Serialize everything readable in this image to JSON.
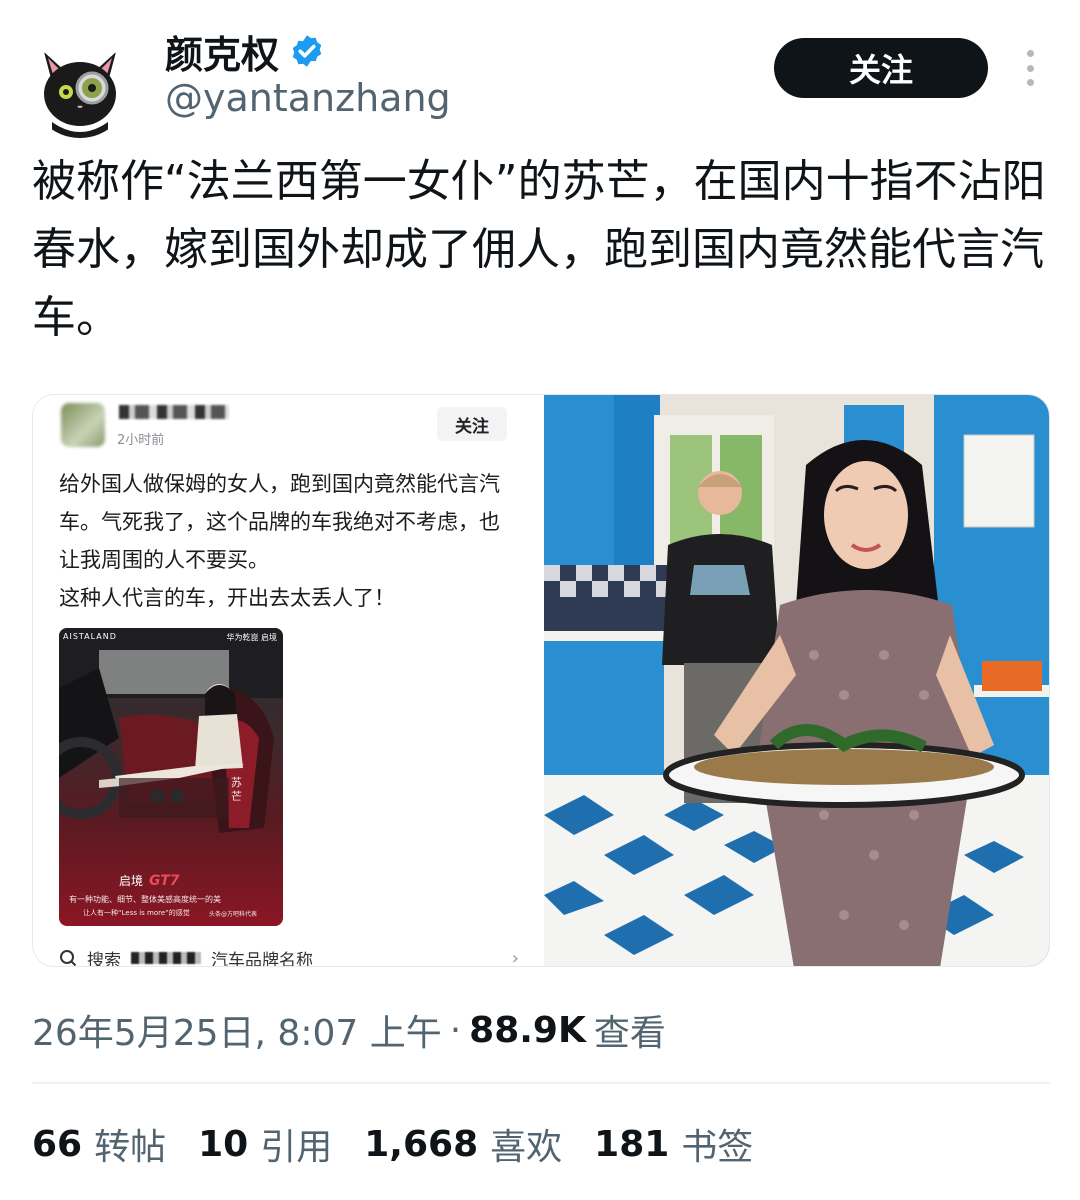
{
  "author": {
    "display_name": "颜克权",
    "handle": "@yantanzhang",
    "verified": true,
    "avatar": "black-cat-avatar"
  },
  "actions": {
    "follow_label": "关注",
    "more_icon": "more-vertical-icon"
  },
  "tweet": {
    "text": "被称作“法兰西第一女仆”的苏芒，在国内十指不沾阳春水，嫁到国外却成了佣人，跑到国内竟然能代言汽车。"
  },
  "media": {
    "left": {
      "post_time": "2小时前",
      "follow_label": "关注",
      "post_text": "给外国人做保姆的女人，跑到国内竟然能代言汽车。气死我了，这个品牌的车我绝对不考虑，也让我周围的人不要买。\n这种人代言的车，开出去太丢人了！",
      "ad": {
        "brand_left": "AISTALAND",
        "brand_right": "华为乾崑  启境",
        "vertical_name": "苏芒",
        "model_cn": "启境",
        "model_en": "GT7",
        "tagline_1": "有一种功能、细节、整体美感高度统一的美",
        "tagline_2": "让人有一种“Less is more”的感觉",
        "watermark": "头条@方吧科代表"
      },
      "search_label": "搜索",
      "search_hint": "汽车品牌名称"
    }
  },
  "meta": {
    "timestamp": "26年5月25日, 8:07 上午",
    "separator": "·",
    "views_count": "88.9K",
    "views_label": "查看"
  },
  "stats": {
    "reposts_count": "66",
    "reposts_label": "转帖",
    "quotes_count": "10",
    "quotes_label": "引用",
    "likes_count": "1,668",
    "likes_label": "喜欢",
    "bookmarks_count": "181",
    "bookmarks_label": "书签"
  },
  "colors": {
    "text_primary": "#0f1419",
    "text_secondary": "#536471",
    "verified_blue": "#1d9bf0",
    "button_dark": "#0f1419",
    "divider": "#eff3f4",
    "kitchen_blue": "#2a8fd0"
  }
}
